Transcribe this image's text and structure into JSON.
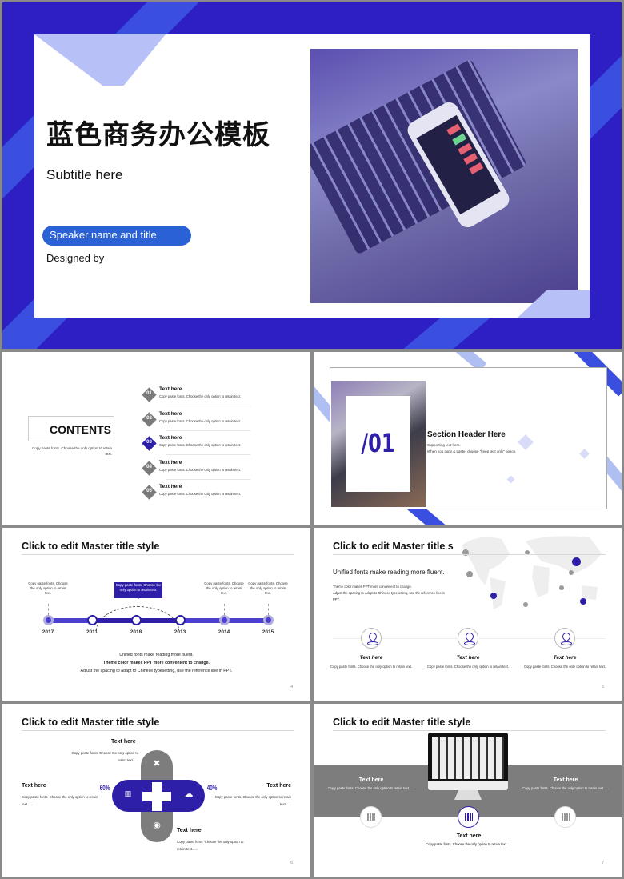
{
  "slides": {
    "title": {
      "heading": "蓝色商务办公模板",
      "subtitle": "Subtitle here",
      "speaker_pill": "Speaker name and title",
      "designed_by": "Designed by",
      "colors": {
        "primary": "#2d1fc4",
        "accent": "#3a4ee0",
        "light": "#b7c1f7",
        "pill": "#2a62d6"
      }
    },
    "contents": {
      "title": "CONTENTS",
      "note": "Copy paste fonts. Choose the only option to retain text.",
      "items": [
        {
          "num": "01",
          "head": "Text here",
          "desc": "Copy paste fonts. Choose the only option to retain text.",
          "active": false
        },
        {
          "num": "02",
          "head": "Text here",
          "desc": "Copy paste fonts. Choose the only option to retain text.",
          "active": false
        },
        {
          "num": "03",
          "head": "Text here",
          "desc": "Copy paste fonts. Choose the only option to retain text.",
          "active": true
        },
        {
          "num": "04",
          "head": "Text here",
          "desc": "Copy paste fonts. Choose the only option to retain text.",
          "active": false
        },
        {
          "num": "05",
          "head": "Text here",
          "desc": "Copy paste fonts. Choose the only option to retain text.",
          "active": false
        }
      ]
    },
    "section": {
      "number": "/01",
      "header": "Section Header Here",
      "line1": "Supporting text here.",
      "line2": "When you copy & paste, choose \"keep text only\" option."
    },
    "timeline": {
      "title": "Click to edit Master title style",
      "years": [
        "2017",
        "2011",
        "2018",
        "2013",
        "2014",
        "2015"
      ],
      "caption": "Copy paste fonts. Choose the only option to retain text.",
      "bubble": "Copy paste fonts. Choose the only option to retain text.",
      "footer": [
        "Unified fonts make reading more fluent.",
        "Theme color makes PPT more convenient to change.",
        "Adjust the spacing to adapt to Chinese typesetting, use the reference line in PPT."
      ],
      "page": "4"
    },
    "map": {
      "title": "Click to edit Master title s",
      "lead": "Unified fonts make reading more fluent.",
      "small1": "Theme color makes PPT more convenient to change.",
      "small2": "Adjust the spacing to adapt to Chinese typesetting, use the reference line in PPT.",
      "columns": [
        {
          "head": "Text here",
          "desc": "Copy paste fonts. Choose the only option to retain text."
        },
        {
          "head": "Text here",
          "desc": "Copy paste fonts. Choose the only option to retain text."
        },
        {
          "head": "Text here",
          "desc": "Copy paste fonts. Choose the only option to retain text."
        }
      ],
      "page": "5"
    },
    "cross": {
      "title": "Click to edit Master title style",
      "top": {
        "head": "Text here",
        "desc": "Copy paste fonts. Choose the only option to retain text......"
      },
      "left": {
        "head": "Text here",
        "desc": "Copy paste fonts. Choose the only option to retain text......",
        "pct": "60%"
      },
      "right": {
        "head": "Text here",
        "desc": "Copy paste fonts. Choose the only option to retain text......",
        "pct": "40%"
      },
      "bottom": {
        "head": "Text here",
        "desc": "Copy paste fonts. Choose the only option to retain text......"
      },
      "page": "6"
    },
    "monitor": {
      "title": "Click to edit Master title style",
      "left": {
        "head": "Text here",
        "desc": "Copy paste fonts. Choose the only option to retain text......"
      },
      "right": {
        "head": "Text here",
        "desc": "Copy paste fonts. Choose the only option to retain text......"
      },
      "center": {
        "head": "Text here",
        "desc": "Copy paste fonts. Choose the only option to retain text......"
      },
      "page": "7"
    }
  }
}
